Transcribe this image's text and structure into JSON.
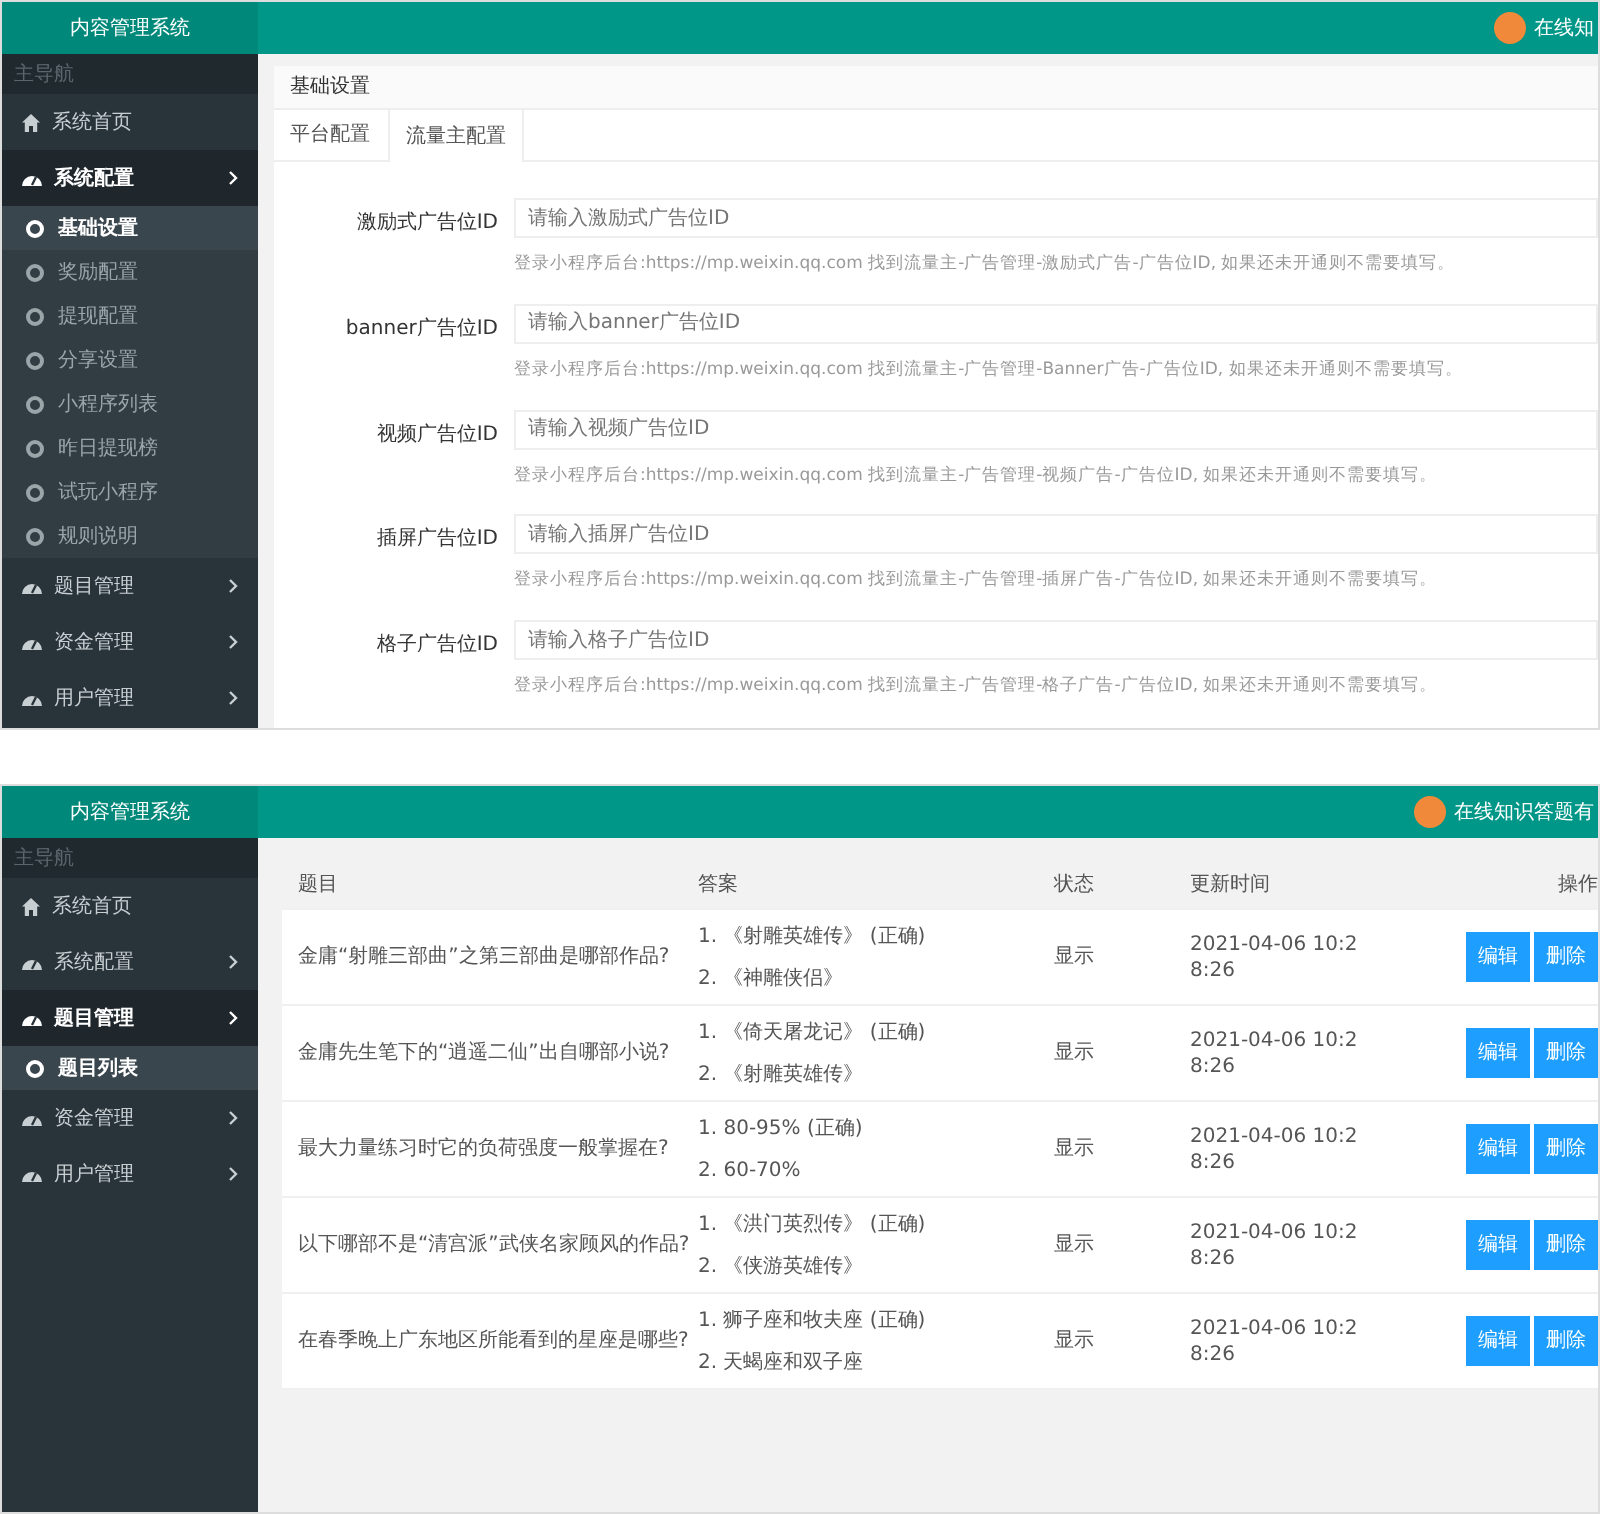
{
  "panels": [
    {
      "kind": "settings",
      "header": {
        "title": "内容管理系统",
        "user": "在线知"
      },
      "sidebar": {
        "label": "主导航",
        "items": [
          {
            "kind": "link",
            "label": "系统首页"
          },
          {
            "kind": "menu",
            "label": "系统配置",
            "expanded": true,
            "children": [
              {
                "label": "基础设置",
                "selected": true
              },
              {
                "label": "奖励配置",
                "selected": false
              },
              {
                "label": "提现配置",
                "selected": false
              },
              {
                "label": "分享设置",
                "selected": false
              },
              {
                "label": "小程序列表",
                "selected": false
              },
              {
                "label": "昨日提现榜",
                "selected": false
              },
              {
                "label": "试玩小程序",
                "selected": false
              },
              {
                "label": "规则说明",
                "selected": false
              }
            ]
          },
          {
            "kind": "menu",
            "label": "题目管理",
            "expanded": false
          },
          {
            "kind": "menu",
            "label": "资金管理",
            "expanded": false
          },
          {
            "kind": "menu",
            "label": "用户管理",
            "expanded": false
          }
        ]
      },
      "content": {
        "title": "基础设置",
        "tabs": [
          {
            "label": "平台配置",
            "selected": false
          },
          {
            "label": "流量主配置",
            "selected": true
          }
        ],
        "fields": [
          {
            "label": "激励式广告位ID",
            "placeholder": "请输入激励式广告位ID",
            "help": "登录小程序后台:https://mp.weixin.qq.com 找到流量主-广告管理-激励式广告-广告位ID, 如果还未开通则不需要填写。"
          },
          {
            "label": "banner广告位ID",
            "placeholder": "请输入banner广告位ID",
            "help": "登录小程序后台:https://mp.weixin.qq.com 找到流量主-广告管理-Banner广告-广告位ID, 如果还未开通则不需要填写。"
          },
          {
            "label": "视频广告位ID",
            "placeholder": "请输入视频广告位ID",
            "help": "登录小程序后台:https://mp.weixin.qq.com 找到流量主-广告管理-视频广告-广告位ID, 如果还未开通则不需要填写。"
          },
          {
            "label": "插屏广告位ID",
            "placeholder": "请输入插屏广告位ID",
            "help": "登录小程序后台:https://mp.weixin.qq.com 找到流量主-广告管理-插屏广告-广告位ID, 如果还未开通则不需要填写。"
          },
          {
            "label": "格子广告位ID",
            "placeholder": "请输入格子广告位ID",
            "help": "登录小程序后台:https://mp.weixin.qq.com 找到流量主-广告管理-格子广告-广告位ID, 如果还未开通则不需要填写。"
          }
        ]
      }
    },
    {
      "kind": "table",
      "header": {
        "title": "内容管理系统",
        "user": "在线知识答题有"
      },
      "sidebar": {
        "label": "主导航",
        "items": [
          {
            "kind": "link",
            "label": "系统首页"
          },
          {
            "kind": "menu",
            "label": "系统配置",
            "expanded": false
          },
          {
            "kind": "menu",
            "label": "题目管理",
            "expanded": true,
            "children": [
              {
                "label": "题目列表",
                "selected": true
              }
            ]
          },
          {
            "kind": "menu",
            "label": "资金管理",
            "expanded": false
          },
          {
            "kind": "menu",
            "label": "用户管理",
            "expanded": false
          }
        ]
      },
      "content": {
        "columns": [
          "题目",
          "答案",
          "状态",
          "更新时间",
          "操作"
        ],
        "rows": [
          {
            "question": "金庸“射雕三部曲”之第三部曲是哪部作品?",
            "answers": [
              "1. 《射雕英雄传》 (正确)",
              "2. 《神雕侠侣》"
            ],
            "status": "显示",
            "updated": "2021-04-06 10:28:26",
            "actions": [
              "编辑",
              "删除"
            ]
          },
          {
            "question": "金庸先生笔下的“逍遥二仙”出自哪部小说?",
            "answers": [
              "1. 《倚天屠龙记》 (正确)",
              "2. 《射雕英雄传》"
            ],
            "status": "显示",
            "updated": "2021-04-06 10:28:26",
            "actions": [
              "编辑",
              "删除"
            ]
          },
          {
            "question": "最大力量练习时它的负荷强度一般掌握在?",
            "answers": [
              "1. 80-95% (正确)",
              "2. 60-70%"
            ],
            "status": "显示",
            "updated": "2021-04-06 10:28:26",
            "actions": [
              "编辑",
              "删除"
            ]
          },
          {
            "question": "以下哪部不是“清宫派”武侠名家顾风的作品?",
            "answers": [
              "1. 《洪门英烈传》 (正确)",
              "2. 《侠游英雄传》"
            ],
            "status": "显示",
            "updated": "2021-04-06 10:28:26",
            "actions": [
              "编辑",
              "删除"
            ]
          },
          {
            "question": "在春季晚上广东地区所能看到的星座是哪些?",
            "answers": [
              "1. 狮子座和牧夫座 (正确)",
              "2. 天蝎座和双子座"
            ],
            "status": "显示",
            "updated": "2021-04-06 10:28:26",
            "actions": [
              "编辑",
              "删除"
            ]
          }
        ]
      }
    }
  ]
}
